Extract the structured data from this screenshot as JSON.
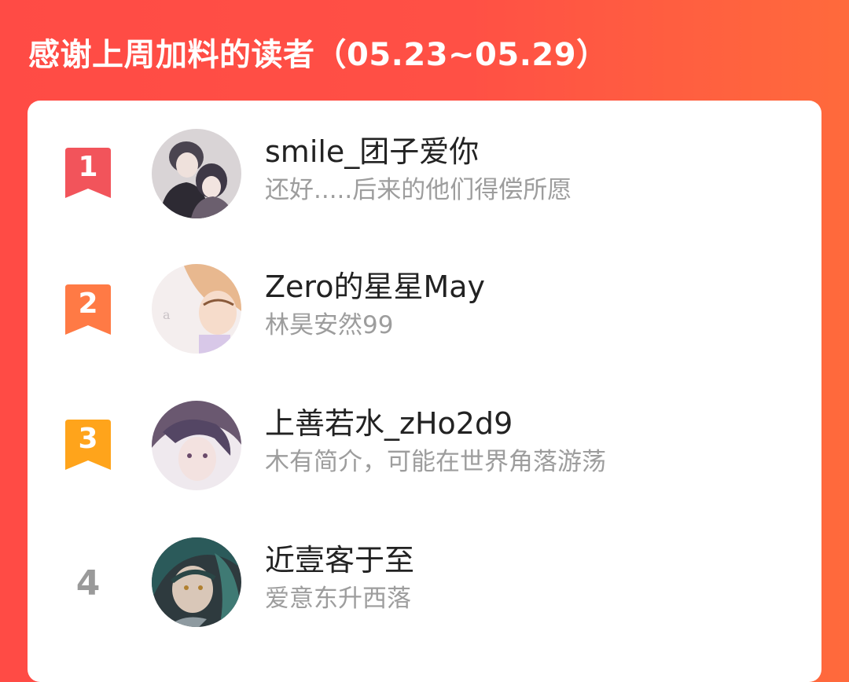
{
  "header": {
    "title": "感谢上周加料的读者（05.23~05.29）"
  },
  "colors": {
    "background": "#ff4d45",
    "rank1": "#f2545b",
    "rank2": "#ff7a45",
    "rank3": "#ffa41b",
    "rank_plain": "#9a9a9a",
    "name": "#222222",
    "subtitle": "#9d9d9d"
  },
  "readers": [
    {
      "rank": "1",
      "name": "smile_团子爱你",
      "subtitle": "还好.....后来的他们得偿所愿",
      "badge_icon": "ribbon-badge-icon"
    },
    {
      "rank": "2",
      "name": "Zero的星星May",
      "subtitle": "林昊安然99",
      "badge_icon": "ribbon-badge-icon"
    },
    {
      "rank": "3",
      "name": "上善若水_zHo2d9",
      "subtitle": "木有简介，可能在世界角落游荡",
      "badge_icon": "ribbon-badge-icon"
    },
    {
      "rank": "4",
      "name": "近壹客于至",
      "subtitle": "爱意东升西落"
    }
  ]
}
